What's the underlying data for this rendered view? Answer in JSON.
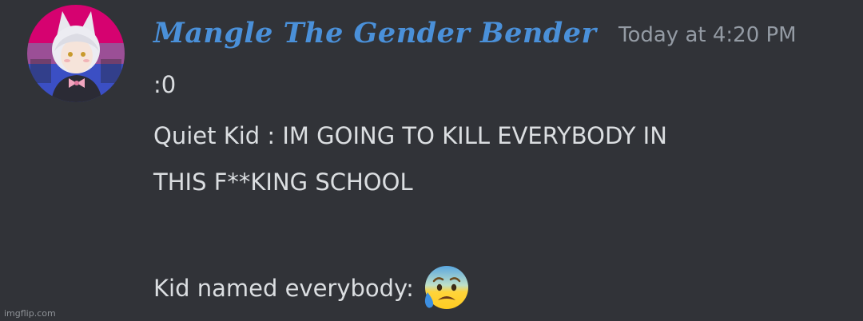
{
  "message": {
    "author": "Mangle The Gender Bender",
    "timestamp": "Today at 4:20 PM",
    "lines": [
      ":0",
      "Quiet Kid : IM GOING TO KILL EVERYBODY IN",
      "THIS F**KING SCHOOL",
      "Kid named everybody:"
    ],
    "emoji": "anxious-face-with-sweat-emoji"
  },
  "watermark": "imgflip.com",
  "colors": {
    "background": "#313338",
    "username": "#4a90d9",
    "text": "#dbdee1",
    "timestamp": "#949ba4"
  }
}
